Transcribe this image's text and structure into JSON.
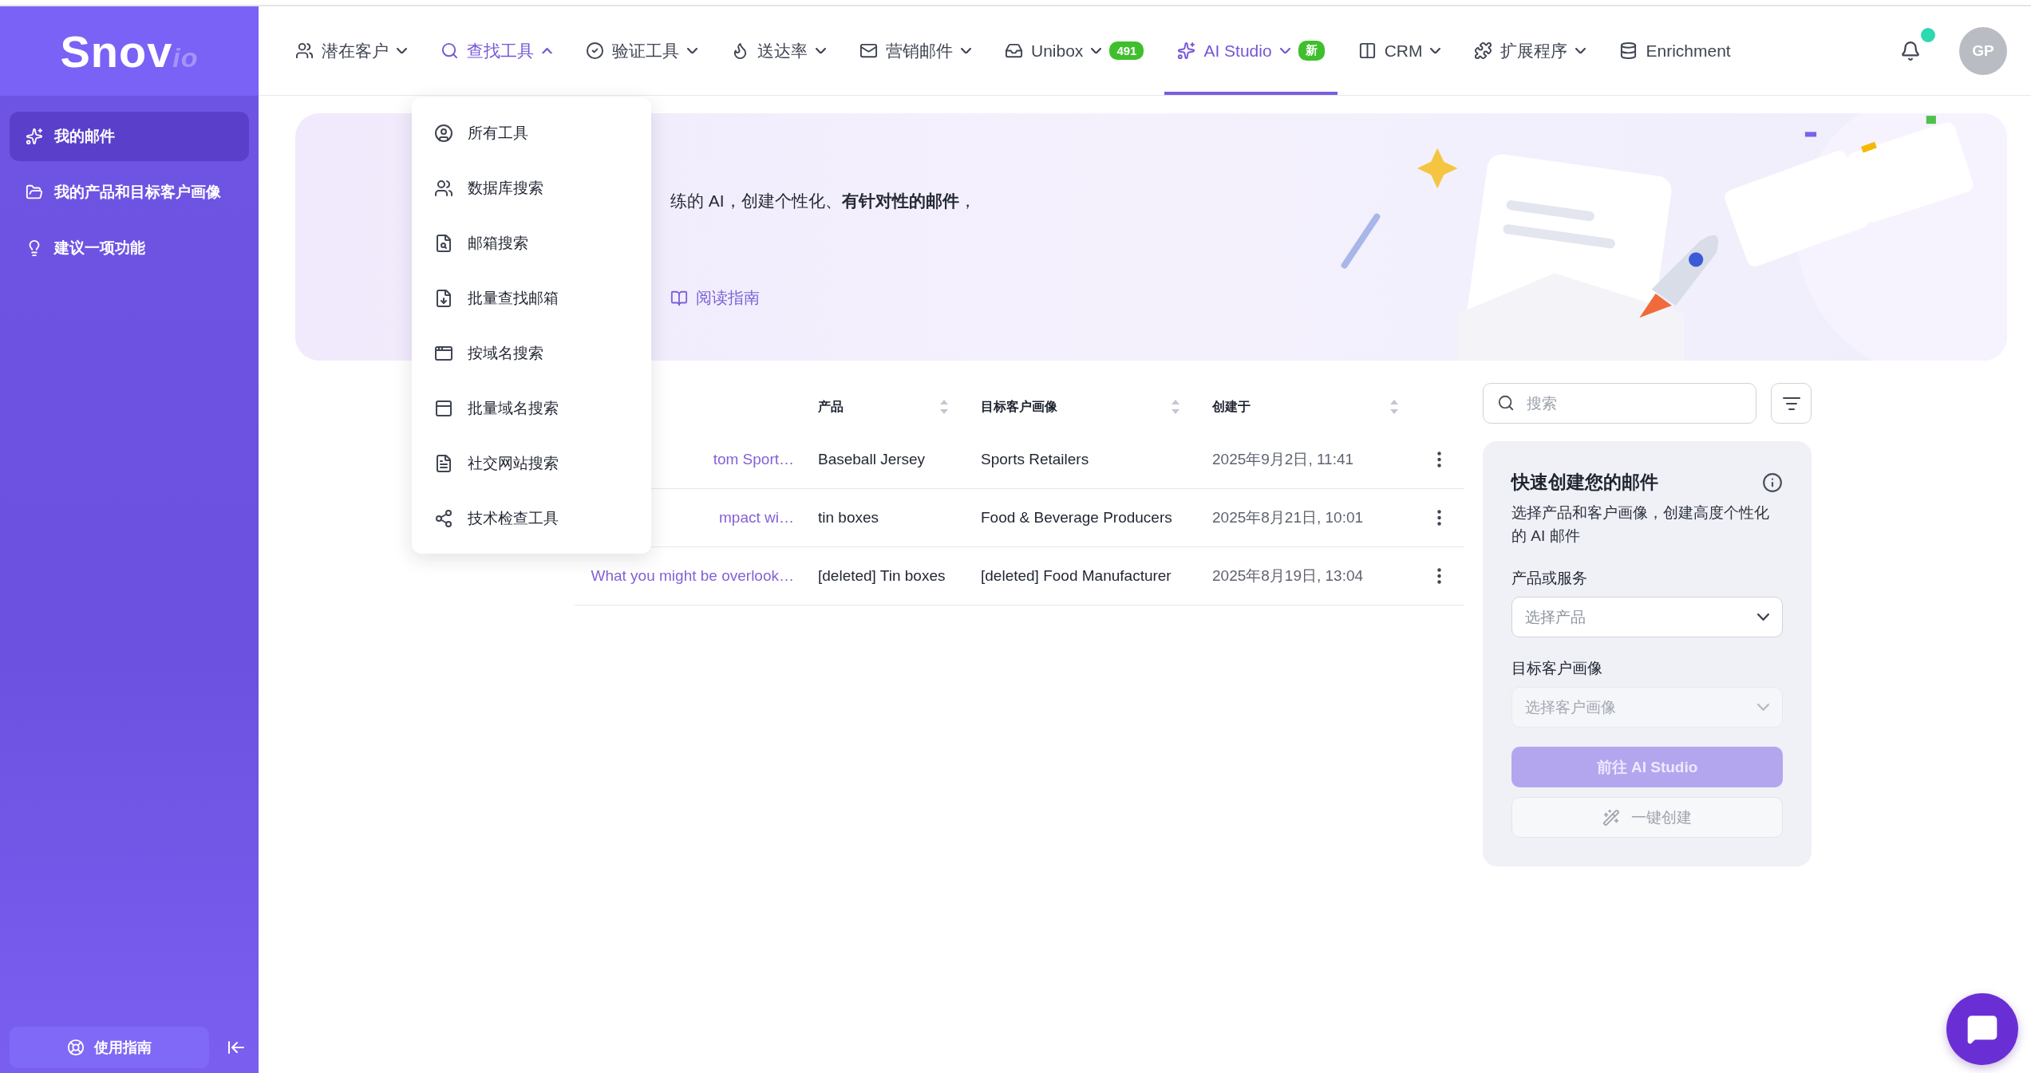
{
  "sidebar": {
    "logo": {
      "text": "Snov",
      "suffix": "io"
    },
    "items": [
      {
        "label": "我的邮件",
        "selected": true
      },
      {
        "label": "我的产品和目标客户画像",
        "selected": false
      },
      {
        "label": "建议一项功能",
        "selected": false
      }
    ],
    "guide_button": "使用指南"
  },
  "nav": {
    "items": [
      {
        "label": "潜在客户",
        "kind": "dropdown",
        "selected": false,
        "expanded": false
      },
      {
        "label": "查找工具",
        "kind": "dropdown",
        "selected": false,
        "expanded": true
      },
      {
        "label": "验证工具",
        "kind": "dropdown",
        "selected": false,
        "expanded": false
      },
      {
        "label": "送达率",
        "kind": "dropdown",
        "selected": false,
        "expanded": false
      },
      {
        "label": "营销邮件",
        "kind": "dropdown",
        "selected": false,
        "expanded": false
      },
      {
        "label": "Unibox",
        "kind": "dropdown",
        "selected": false,
        "expanded": false,
        "badge": "491"
      },
      {
        "label": "AI Studio",
        "kind": "dropdown",
        "selected": true,
        "expanded": false,
        "badge": "新"
      },
      {
        "label": "CRM",
        "kind": "dropdown",
        "selected": false,
        "expanded": false
      },
      {
        "label": "扩展程序",
        "kind": "dropdown",
        "selected": false,
        "expanded": false
      },
      {
        "label": "Enrichment",
        "kind": "link",
        "selected": false,
        "expanded": false
      }
    ]
  },
  "notifications": {
    "unread": true
  },
  "avatar": {
    "initials": "GP"
  },
  "dropdown": {
    "items": [
      {
        "label": "所有工具"
      },
      {
        "label": "数据库搜索"
      },
      {
        "label": "邮箱搜索"
      },
      {
        "label": "批量查找邮箱"
      },
      {
        "label": "按域名搜索"
      },
      {
        "label": "批量域名搜索"
      },
      {
        "label": "社交网站搜索"
      },
      {
        "label": "技术检查工具"
      }
    ]
  },
  "banner": {
    "text": "练的 AI，创建个性化、**有针对性的邮件**，",
    "link": "阅读指南"
  },
  "table": {
    "columns": [
      {
        "label": "产品"
      },
      {
        "label": "目标客户画像"
      },
      {
        "label": "创建于"
      }
    ],
    "rows": [
      {
        "title": "tom Sport…",
        "product": "Baseball Jersey",
        "persona": "Sports Retailers",
        "created": "2025年9月2日, 11:41"
      },
      {
        "title": "mpact wi…",
        "product": "tin boxes",
        "persona": "Food & Beverage Producers",
        "created": "2025年8月21日, 10:01"
      },
      {
        "title": "What you might be overlook…",
        "product": "[deleted] Tin boxes",
        "persona": "[deleted] Food Manufacturer",
        "created": "2025年8月19日, 13:04"
      }
    ]
  },
  "search": {
    "placeholder": "搜索"
  },
  "quick_create": {
    "title": "快速创建您的邮件",
    "description": "选择产品和客户画像，创建高度个性化的 AI 邮件",
    "fields": [
      {
        "label": "产品或服务",
        "placeholder": "选择产品",
        "disabled": false
      },
      {
        "label": "目标客户画像",
        "placeholder": "选择客户画像",
        "disabled": true
      }
    ],
    "primary_button": {
      "label": "前往 AI Studio",
      "disabled": true
    },
    "secondary_button": {
      "label": "一键创建",
      "disabled": true
    }
  }
}
